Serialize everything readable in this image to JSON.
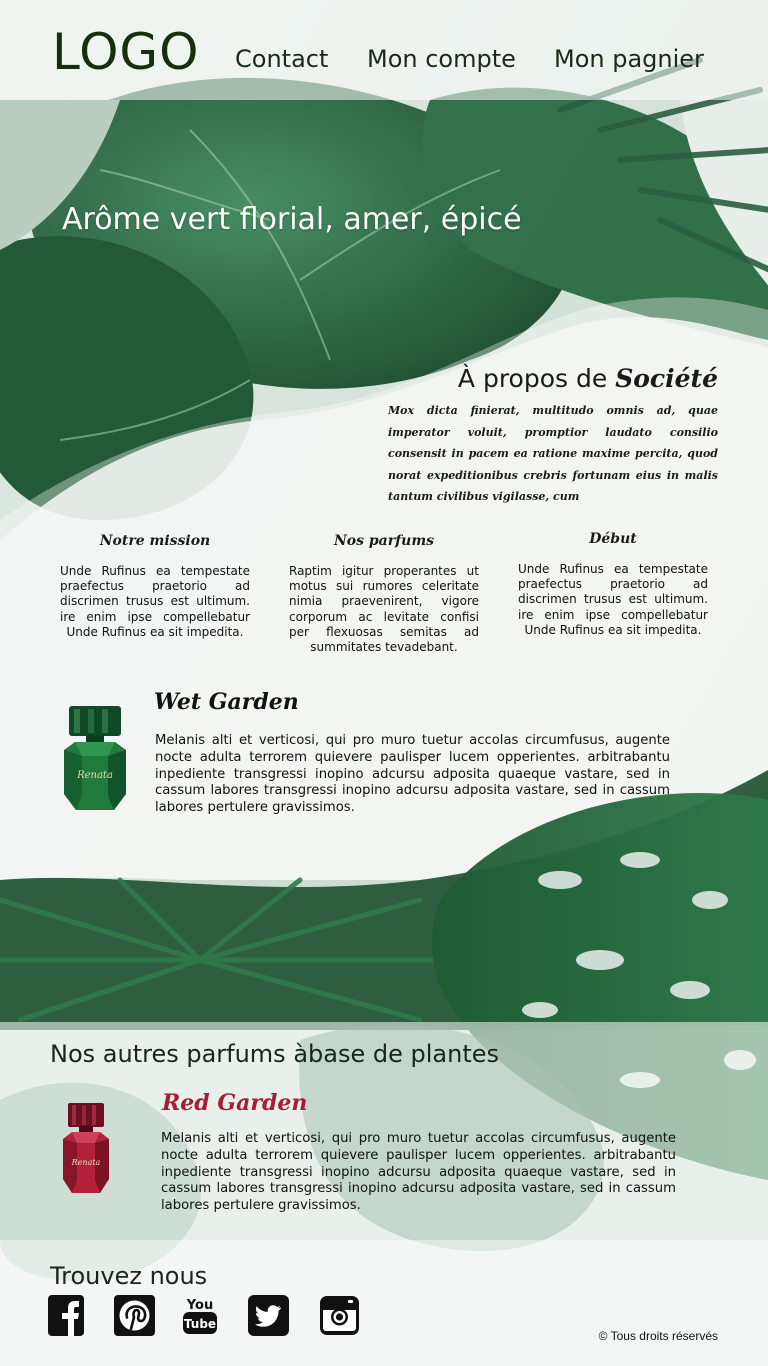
{
  "header": {
    "logo": "LOGO",
    "nav": [
      {
        "label": "Contact"
      },
      {
        "label": "Mon compte"
      },
      {
        "label": "Mon pagnier"
      }
    ]
  },
  "hero": {
    "title": "Arôme vert florial, amer, épicé"
  },
  "about": {
    "title_prefix": "À propos de ",
    "title_brand": "Société",
    "text": "Mox dicta finierat, multitudo omnis ad, quae imperator voluit, promptior laudato consilio consensit in pacem ea ratione maxime percita, quod norat expeditionibus crebris fortunam eius in malis tantum civilibus vigilasse, cum"
  },
  "columns": [
    {
      "title": "Notre mission",
      "text": "Unde Rufinus ea tempestate praefectus praetorio ad discrimen trusus est ultimum. ire enim ipse compellebatur Unde Rufinus ea sit impedita."
    },
    {
      "title": "Nos parfums",
      "text": "Raptim igitur properantes ut motus sui rumores celeritate nimia praevenirent, vigore corporum ac levitate confisi per flexuosas semitas ad summitates tevadebant."
    },
    {
      "title": "Début",
      "text": "Unde Rufinus ea tempestate praefectus praetorio ad discrimen trusus est ultimum. ire enim ipse compellebatur Unde Rufinus ea sit impedita."
    }
  ],
  "featured": {
    "name": "Wet Garden",
    "bottle_label": "Renata",
    "description": "Melanis alti et verticosi, qui pro muro tuetur accolas circumfusus, augente nocte adulta terrorem quievere paulisper lucem opperientes. arbitrabantu inpediente transgressi inopino adcursu adposita quaeque vastare, sed in cassum labores transgressi inopino adcursu adposita vastare, sed in cassum labores pertulere gravissimos.",
    "color": "#1f7a3c"
  },
  "others": {
    "title": "Nos autres parfums àbase de plantes",
    "products": [
      {
        "name": "Red Garden",
        "bottle_label": "Renata",
        "description": "Melanis alti et verticosi, qui pro muro tuetur accolas circumfusus, augente nocte adulta terrorem quievere paulisper lucem opperientes. arbitrabantu inpediente transgressi inopino adcursu adposita quaeque vastare, sed in cassum labores transgressi inopino adcursu adposita vastare, sed in cassum labores pertulere gravissimos.",
        "color": "#b3223a"
      }
    ]
  },
  "footer": {
    "title": "Trouvez nous",
    "social": [
      "facebook-icon",
      "pinterest-icon",
      "youtube-icon",
      "twitter-icon",
      "instagram-icon"
    ],
    "youtube_text": "You\nTube",
    "copyright": "© Tous droits réservés"
  }
}
